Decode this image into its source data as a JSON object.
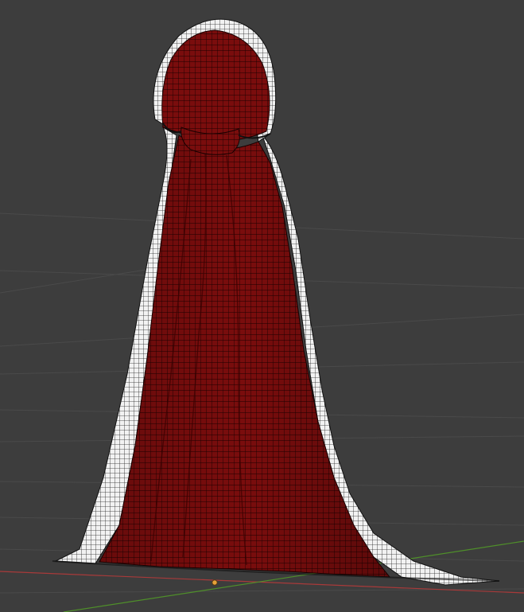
{
  "viewport": {
    "background": "#3d3d3d",
    "grid_color": "#4a4a4a",
    "x_axis_color": "#a83a3a",
    "y_axis_color": "#4f8f2a",
    "origin_color": "#e8a23a"
  },
  "object": {
    "name": "hooded-cloak",
    "outer_color": "#7a0d0d",
    "wire_color": "#1a0000",
    "trim_color": "#f2f2f2",
    "trim_wire_color": "#111111"
  }
}
